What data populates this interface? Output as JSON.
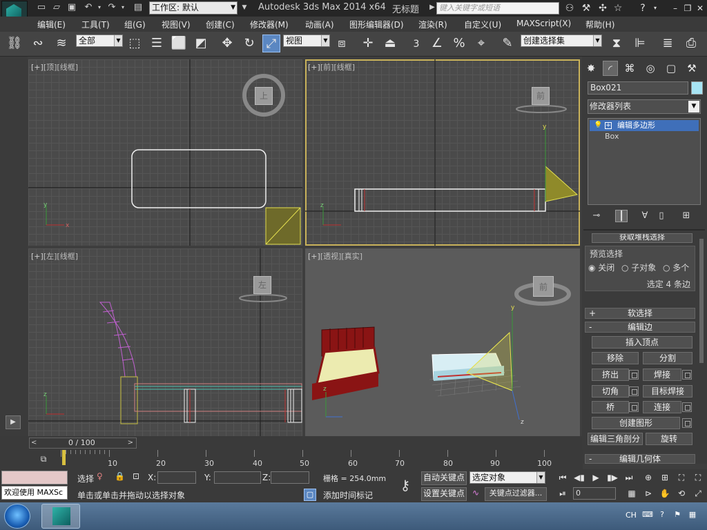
{
  "title_bar": {
    "workspace": "工作区: 默认",
    "app_title": "Autodesk 3ds Max  2014 x64",
    "doc_title": "无标题",
    "search_placeholder": "键入关键字或短语"
  },
  "menu": [
    "编辑(E)",
    "工具(T)",
    "组(G)",
    "视图(V)",
    "创建(C)",
    "修改器(M)",
    "动画(A)",
    "图形编辑器(D)",
    "渲染(R)",
    "自定义(U)",
    "MAXScript(X)",
    "帮助(H)"
  ],
  "toolbar": {
    "selection_filter": "全部",
    "ref_coord": "视图",
    "snap_value": "3",
    "named_selection": "创建选择集"
  },
  "viewports": [
    {
      "id": "top",
      "plus": "[+]",
      "name": "[顶]",
      "mode": "[线框]",
      "cube_label": "上"
    },
    {
      "id": "front",
      "plus": "[+]",
      "name": "[前]",
      "mode": "[线框]",
      "cube_label": "前"
    },
    {
      "id": "left",
      "plus": "[+]",
      "name": "[左]",
      "mode": "[线框]",
      "cube_label": "左"
    },
    {
      "id": "persp",
      "plus": "[+]",
      "name": "[透视]",
      "mode": "[真实]",
      "cube_label": "前"
    }
  ],
  "command_panel": {
    "object_name": "Box021",
    "object_color": "#a7e4f4",
    "modifier_list": "修改器列表",
    "stack": [
      "编辑多边形",
      "Box"
    ],
    "rollout_clipped": "获取堆栈选择",
    "preview_selection": {
      "title": "预览选择",
      "options": [
        "关闭",
        "子对象",
        "多个"
      ],
      "selected": "关闭",
      "status": "选定 4 条边"
    },
    "rollouts": {
      "soft_selection": "软选择",
      "edit_edges": "编辑边",
      "edit_geometry": "编辑几何体"
    },
    "edit_edges_buttons": {
      "insert_vertex": "插入顶点",
      "remove": "移除",
      "split": "分割",
      "extrude": "挤出",
      "weld": "焊接",
      "chamfer": "切角",
      "target_weld": "目标焊接",
      "bridge": "桥",
      "connect": "连接",
      "create_shape": "创建图形",
      "edit_tri": "编辑三角剖分",
      "turn": "旋转"
    }
  },
  "time_slider": {
    "label": "0 / 100"
  },
  "trackbar": {
    "ticks": [
      "10",
      "20",
      "30",
      "40",
      "50",
      "60",
      "70",
      "80",
      "90",
      "100"
    ]
  },
  "status": {
    "maxscript_welcome": "欢迎使用 MAXSc",
    "sel_label": "选择",
    "x_label": "X:",
    "y_label": "Y:",
    "z_label": "Z:",
    "grid": "栅格 = 254.0mm",
    "prompt": "单击或单击并拖动以选择对象",
    "add_time_tag": "添加时间标记",
    "auto_key": "自动关键点",
    "set_key": "设置关键点",
    "key_mode": "选定对象",
    "key_filters": "关键点过滤器...",
    "frame": "0"
  },
  "taskbar": {
    "lang": "CH"
  }
}
